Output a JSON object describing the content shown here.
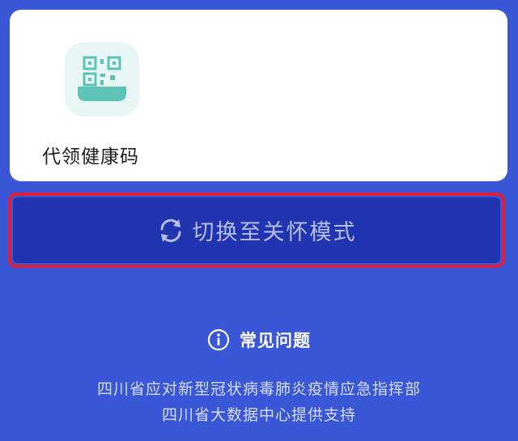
{
  "service_card": {
    "tile_label": "代领健康码",
    "icon": "qr-code-icon"
  },
  "mode_button": {
    "label": "切换至关怀模式",
    "icon": "refresh-icon"
  },
  "faq": {
    "label": "常见问题",
    "icon": "info-icon"
  },
  "footer": {
    "line1": "四川省应对新型冠状病毒肺炎疫情应急指挥部",
    "line2": "四川省大数据中心提供支持"
  },
  "colors": {
    "background": "#3a57d8",
    "button": "#2235b0",
    "highlight_border": "#e0203a",
    "icon_teal": "#5cc3b6"
  }
}
